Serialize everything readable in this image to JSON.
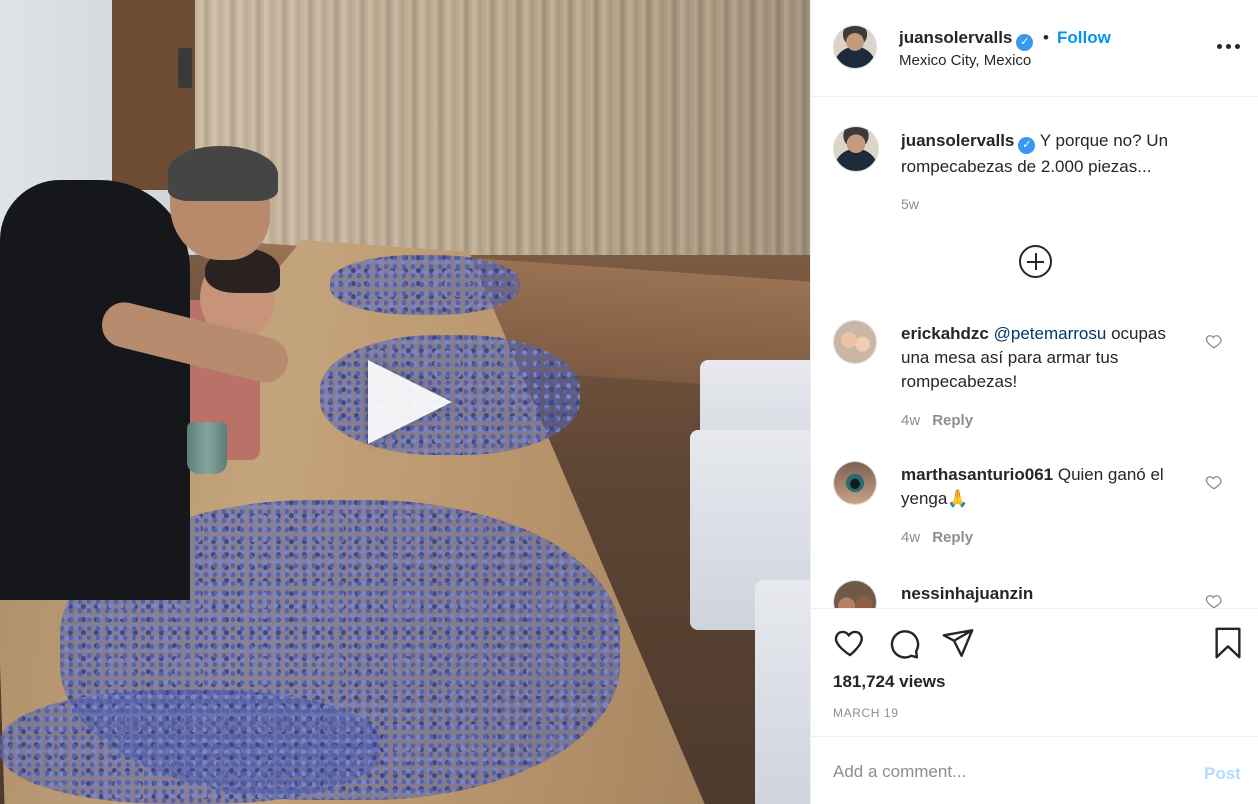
{
  "media": {
    "type": "video",
    "description_icon": "play-icon"
  },
  "header": {
    "username": "juansolervalls",
    "verified": true,
    "separator": "•",
    "follow_label": "Follow",
    "location": "Mexico City, Mexico",
    "more_icon": "more-horizontal-icon"
  },
  "caption": {
    "username": "juansolervalls",
    "text": " Y porque no? Un rompecabezas de 2.000 piezas...",
    "time": "5w"
  },
  "load_more_icon": "plus-circle-icon",
  "comments": [
    {
      "username": "erickahdzc",
      "mention": "@petemarrosu",
      "text": "ocupas una mesa así para armar tus rompecabezas!",
      "time": "4w",
      "reply_label": "Reply"
    },
    {
      "username": "marthasanturio061",
      "mention": "",
      "text": " Quien ganó el yenga🙏",
      "time": "4w",
      "reply_label": "Reply"
    },
    {
      "username": "nessinhajuanzin",
      "mention": "",
      "text": "",
      "time": "",
      "reply_label": ""
    }
  ],
  "actions": {
    "like_icon": "heart-icon",
    "comment_icon": "comment-icon",
    "share_icon": "send-icon",
    "save_icon": "bookmark-icon",
    "views": "181,724 views",
    "date": "MARCH 19"
  },
  "add_comment": {
    "placeholder": "Add a comment...",
    "post_label": "Post"
  },
  "colors": {
    "accent": "#0095f6",
    "post_disabled": "#b3dbff",
    "muted": "#8e8e8e",
    "text": "#262626"
  }
}
